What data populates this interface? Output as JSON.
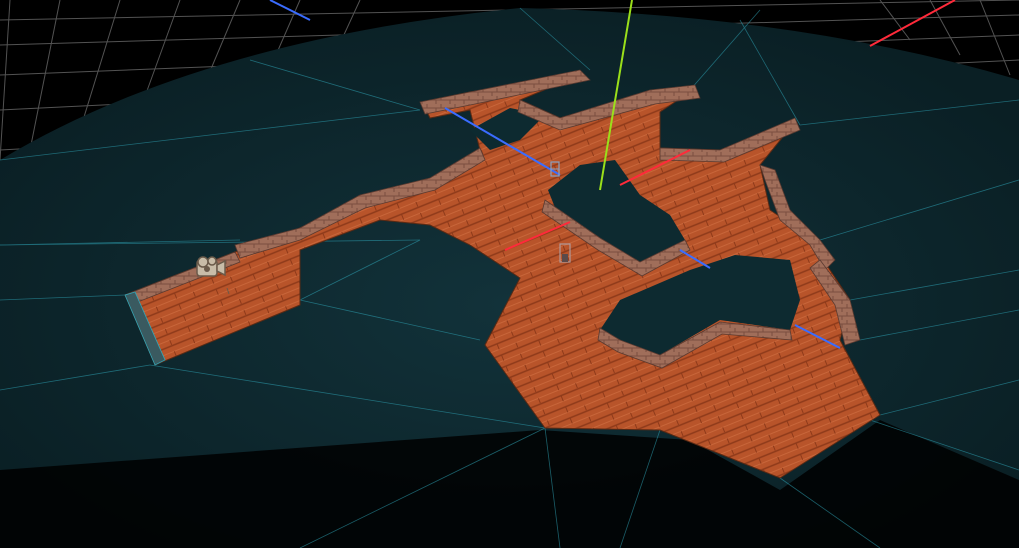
{
  "scene": {
    "view": "editor-3d-viewport",
    "background_color": "#000000",
    "grid_color": "#8a8a8a",
    "navmesh_color": "#0e2a30",
    "navmesh_edge_color": "#2fa6b8",
    "floor_color": "#b8542a",
    "wall_color": "#9a6a58",
    "axis_colors": {
      "x": "#ff2a3a",
      "y": "#9be01a",
      "z": "#3a6cff"
    },
    "icons": [
      "camera-gizmo-icon",
      "light-probe-icon",
      "spawn-marker-icon"
    ]
  }
}
